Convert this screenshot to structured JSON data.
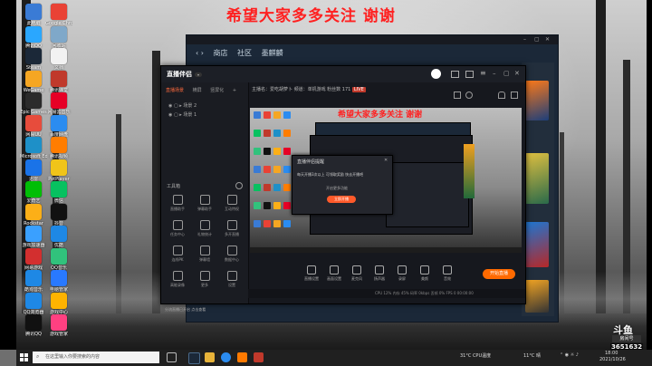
{
  "banner": "希望大家多多关注  谢谢",
  "nested_banner": "希望大家多多关注  谢谢",
  "steam": {
    "nav": [
      "商店",
      "社区",
      "墨麒麟"
    ]
  },
  "app": {
    "logo": "直播伴侣",
    "side_tabs": [
      "直播场景",
      "横屏",
      "竖屏化"
    ],
    "scenes": [
      "场景 2",
      "场景 1"
    ],
    "tool_title": "工具箱",
    "tools": [
      "直播助手",
      "弹幕助手",
      "互动特权",
      "任务中心",
      "礼物统计",
      "多开直播",
      "连线PK",
      "弹幕墙",
      "数据中心",
      "高能录像",
      "更多",
      "设置"
    ],
    "main_info": "主播名：爱吃胡萝卜  频道：单机游戏  粉丝数 171",
    "popup": {
      "title": "直播伴侣提醒",
      "message": "每天开播3次以上 可领取奖励 快去开播吧",
      "link": "开启更多功能",
      "button": "立即开播"
    },
    "bottom_tools": [
      "直播设置",
      "画面设置",
      "麦克风",
      "扬声器",
      "录屏",
      "美颜",
      "音效"
    ],
    "live_button": "开始直播",
    "status": "CPU 12%  内存 45%  码率 0kbps  丢帧 0%  FPS 0  00:00:00",
    "sidebar_status": "分流直播已开启 点击查看"
  },
  "desktop_icons": [
    {
      "label": "此电脑",
      "color": "#3a7bd5"
    },
    {
      "label": "Google Chrome",
      "color": "#e94235"
    },
    {
      "label": "腾讯QQ",
      "color": "#2aa7ff"
    },
    {
      "label": "回收站",
      "color": "#7fa8c9"
    },
    {
      "label": "Steam",
      "color": "#1b2838"
    },
    {
      "label": "文档",
      "color": "#f2f2f2"
    },
    {
      "label": "WeGame",
      "color": "#f5a623"
    },
    {
      "label": "腾讯课堂",
      "color": "#c0392b"
    },
    {
      "label": "Epic Games",
      "color": "#2b2b2b"
    },
    {
      "label": "网易云音乐",
      "color": "#e60026"
    },
    {
      "label": "网易UU",
      "color": "#e74c3c"
    },
    {
      "label": "百度网盘",
      "color": "#2b8cf0"
    },
    {
      "label": "Microsoft Edge",
      "color": "#1e90c8"
    },
    {
      "label": "腾讯视频",
      "color": "#ff7d00"
    },
    {
      "label": "迅雷",
      "color": "#1a73e8"
    },
    {
      "label": "PotPlayer",
      "color": "#f0c419"
    },
    {
      "label": "爱奇艺",
      "color": "#00be06"
    },
    {
      "label": "微信",
      "color": "#07c160"
    },
    {
      "label": "Rockstar",
      "color": "#fcaf17"
    },
    {
      "label": "抖音",
      "color": "#111111"
    },
    {
      "label": "游戏加速器",
      "color": "#3aa0ff"
    },
    {
      "label": "优酷",
      "color": "#1e88e5"
    },
    {
      "label": "网易游戏",
      "color": "#d32f2f"
    },
    {
      "label": "QQ音乐",
      "color": "#31c27c"
    },
    {
      "label": "酷狗音乐",
      "color": "#1e88e5"
    },
    {
      "label": "电脑管家",
      "color": "#2979ff"
    },
    {
      "label": "QQ浏览器",
      "color": "#1e88e5"
    },
    {
      "label": "游戏中心",
      "color": "#ffb300"
    },
    {
      "label": "腾讯QQ",
      "color": "#111111"
    },
    {
      "label": "游戏管家",
      "color": "#ff4081"
    }
  ],
  "taskbar": {
    "search_placeholder": "在这里输入你要搜索的内容",
    "weather": "11°C 晴",
    "time": "18:00",
    "date": "2021/10/26",
    "cpu_label": "31°C CPU温度"
  },
  "douyu": {
    "brand": "斗鱼",
    "tag": "房间号",
    "room": "3651632"
  }
}
